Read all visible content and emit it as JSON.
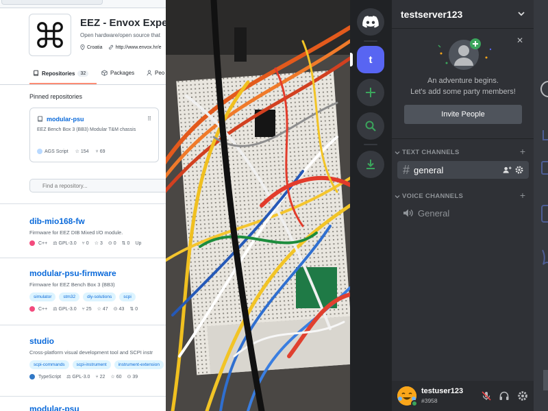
{
  "github": {
    "org_name": "EEZ - Envox Exper",
    "org_description": "Open hardware/open source that",
    "location": "Croatia",
    "website": "http://www.envox.hr/e",
    "tabs": [
      {
        "label": "Repositories",
        "count": "32"
      },
      {
        "label": "Packages"
      },
      {
        "label": "Peo"
      }
    ],
    "pinned_title": "Pinned repositories",
    "pinned": {
      "name": "modular-psu",
      "description": "EEZ Bench Box 3 (BB3) Modular T&M chassis",
      "language": "AGS Script",
      "language_color": "#b9d9ff",
      "stars": "154",
      "forks": "69"
    },
    "search_placeholder": "Find a repository...",
    "repos": [
      {
        "name": "dib-mio168-fw",
        "description": "Firmware for EEZ DIB Mixed I/O module.",
        "topics": [],
        "language": "C++",
        "language_color": "#f34b7d",
        "license": "GPL-3.0",
        "forks": "0",
        "stars": "3",
        "issues": "0",
        "prs": "0",
        "updated": "Up"
      },
      {
        "name": "modular-psu-firmware",
        "description": "Firmware for EEZ Bench Box 3 (BB3)",
        "topics": [
          "simulator",
          "stm32",
          "diy-solutions",
          "scpi"
        ],
        "language": "C++",
        "language_color": "#f34b7d",
        "license": "GPL-3.0",
        "forks": "25",
        "stars": "47",
        "issues": "43",
        "prs": "0"
      },
      {
        "name": "studio",
        "description": "Cross-platform visual development tool and SCPI instr",
        "topics": [
          "scpi-commands",
          "scpi-instrument",
          "instrument-extension"
        ],
        "language": "TypeScript",
        "language_color": "#3178c6",
        "license": "GPL-3.0",
        "forks": "22",
        "stars": "60",
        "issues": "39",
        "prs": ""
      },
      {
        "name": "modular-psu"
      }
    ]
  },
  "discord": {
    "server_letter": "t",
    "server_name": "testserver123",
    "welcome_line1": "An adventure begins.",
    "welcome_line2": "Let's add some party members!",
    "invite_label": "Invite People",
    "text_category": "TEXT CHANNELS",
    "voice_category": "VOICE CHANNELS",
    "text_channels": [
      {
        "name": "general"
      }
    ],
    "voice_channels": [
      {
        "name": "General"
      }
    ],
    "user": {
      "name": "testuser123",
      "tag": "#3958"
    },
    "colors": {
      "blurple": "#5865f2",
      "green": "#3ba55c",
      "rail": "#202225",
      "sidebar": "#2f3136"
    }
  }
}
